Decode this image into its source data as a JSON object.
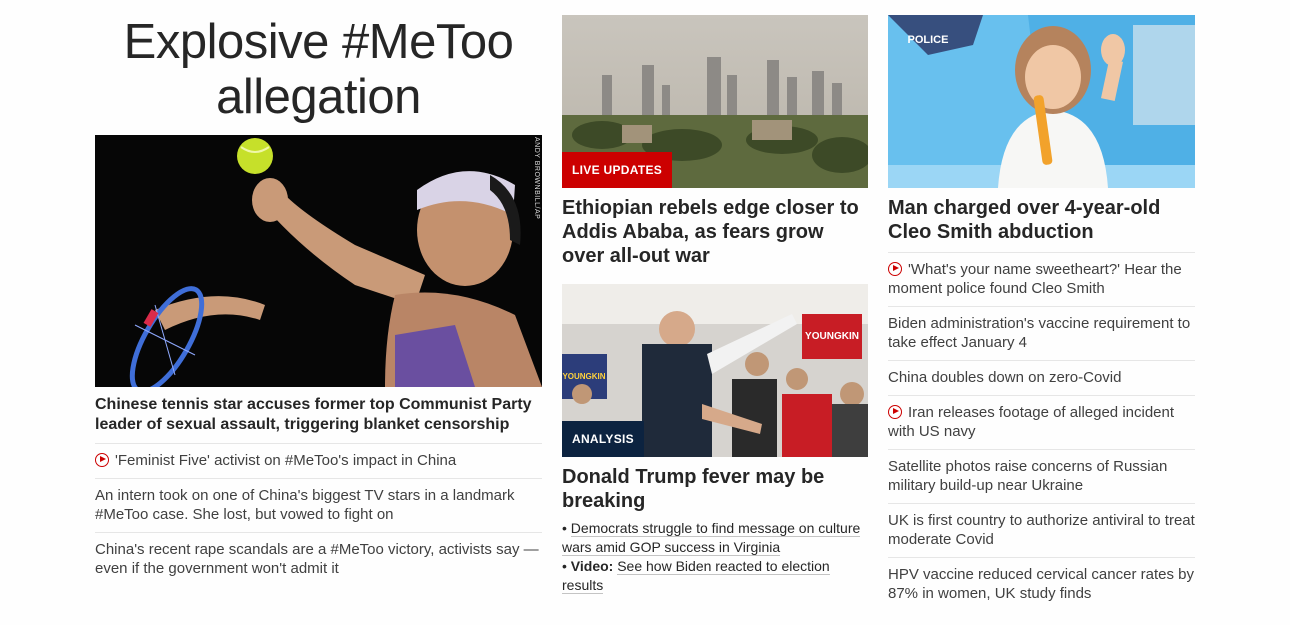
{
  "left": {
    "section_title": "Explosive #MeToo allegation",
    "photo_credit": "ANDY BROWNBILL/AP",
    "lead_headline": "Chinese tennis star accuses former top Communist Party leader of sexual assault, triggering blanket censorship",
    "links": [
      {
        "text": "'Feminist Five' activist on #MeToo's impact in China",
        "video": true
      },
      {
        "text": "An intern took on one of China's biggest TV stars in a landmark #MeToo case. She lost, but vowed to fight on",
        "video": false
      },
      {
        "text": "China's recent rape scandals are a #MeToo victory, activists say — even if the government won't admit it",
        "video": false
      }
    ]
  },
  "middle": {
    "story1": {
      "badge": "LIVE UPDATES",
      "headline": "Ethiopian rebels edge closer to Addis Ababa, as fears grow over all-out war"
    },
    "story2": {
      "badge": "ANALYSIS",
      "sign_text_1": "YOUNGKIN",
      "sign_text_2": "YOUNGKIN",
      "headline": "Donald Trump fever may be breaking",
      "bullet1": "Democrats struggle to find message on culture wars amid GOP success in Virginia",
      "bullet2_prefix": "Video:",
      "bullet2": "See how Biden reacted to election results"
    }
  },
  "right": {
    "image_text": "POLICE",
    "headline": "Man charged over 4-year-old Cleo Smith abduction",
    "links": [
      {
        "text": "'What's your name sweetheart?' Hear the moment police found Cleo Smith",
        "video": true
      },
      {
        "text": "Biden administration's vaccine requirement to take effect January 4",
        "video": false
      },
      {
        "text": "China doubles down on zero-Covid",
        "video": false
      },
      {
        "text": "Iran releases footage of alleged incident with US navy",
        "video": true
      },
      {
        "text": "Satellite photos raise concerns of Russian military build-up near Ukraine",
        "video": false
      },
      {
        "text": "UK is first country to authorize antiviral to treat moderate Covid",
        "video": false
      },
      {
        "text": "HPV vaccine reduced cervical cancer rates by 87% in women, UK study finds",
        "video": false
      }
    ]
  }
}
